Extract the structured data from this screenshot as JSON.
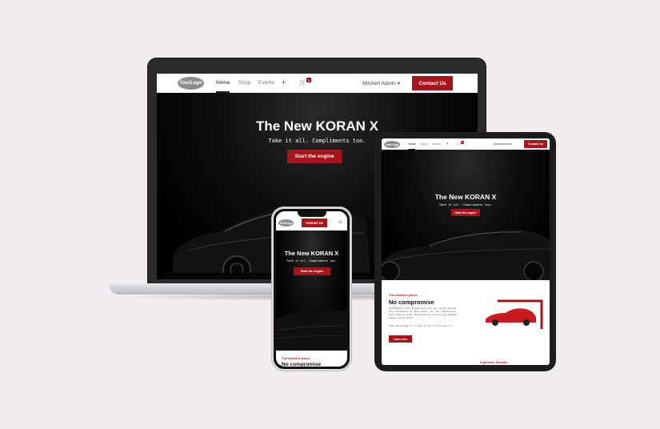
{
  "site": {
    "logo_text": "YourLogo",
    "nav": {
      "items": [
        "Home",
        "Shop",
        "Events"
      ],
      "plus_icon": "plus-icon",
      "cart_icon": "cart-icon",
      "cart_count": "0",
      "user": "Mitchell Admin",
      "user_caret": "▾",
      "contact_label": "Contact Us"
    },
    "hero": {
      "title": "The New KORAN X",
      "subtitle": "Take it all. Compliments too.",
      "button_label": "Start the engine"
    },
    "section": {
      "kicker": "The world is yours",
      "title": "No compromise",
      "text1": "Performance and design were the key words during the conception of this super car. No compromises were made to keep the pleasure of driving despite these constraints.",
      "text2": "Take advantage of a free trial to discover it.",
      "button_label": "Learn more",
      "next_heading": "A greener lifestyle"
    },
    "tablet_user": "Mitchell Admin"
  },
  "colors": {
    "accent": "#a8141a",
    "background": "#f1ecf0"
  }
}
